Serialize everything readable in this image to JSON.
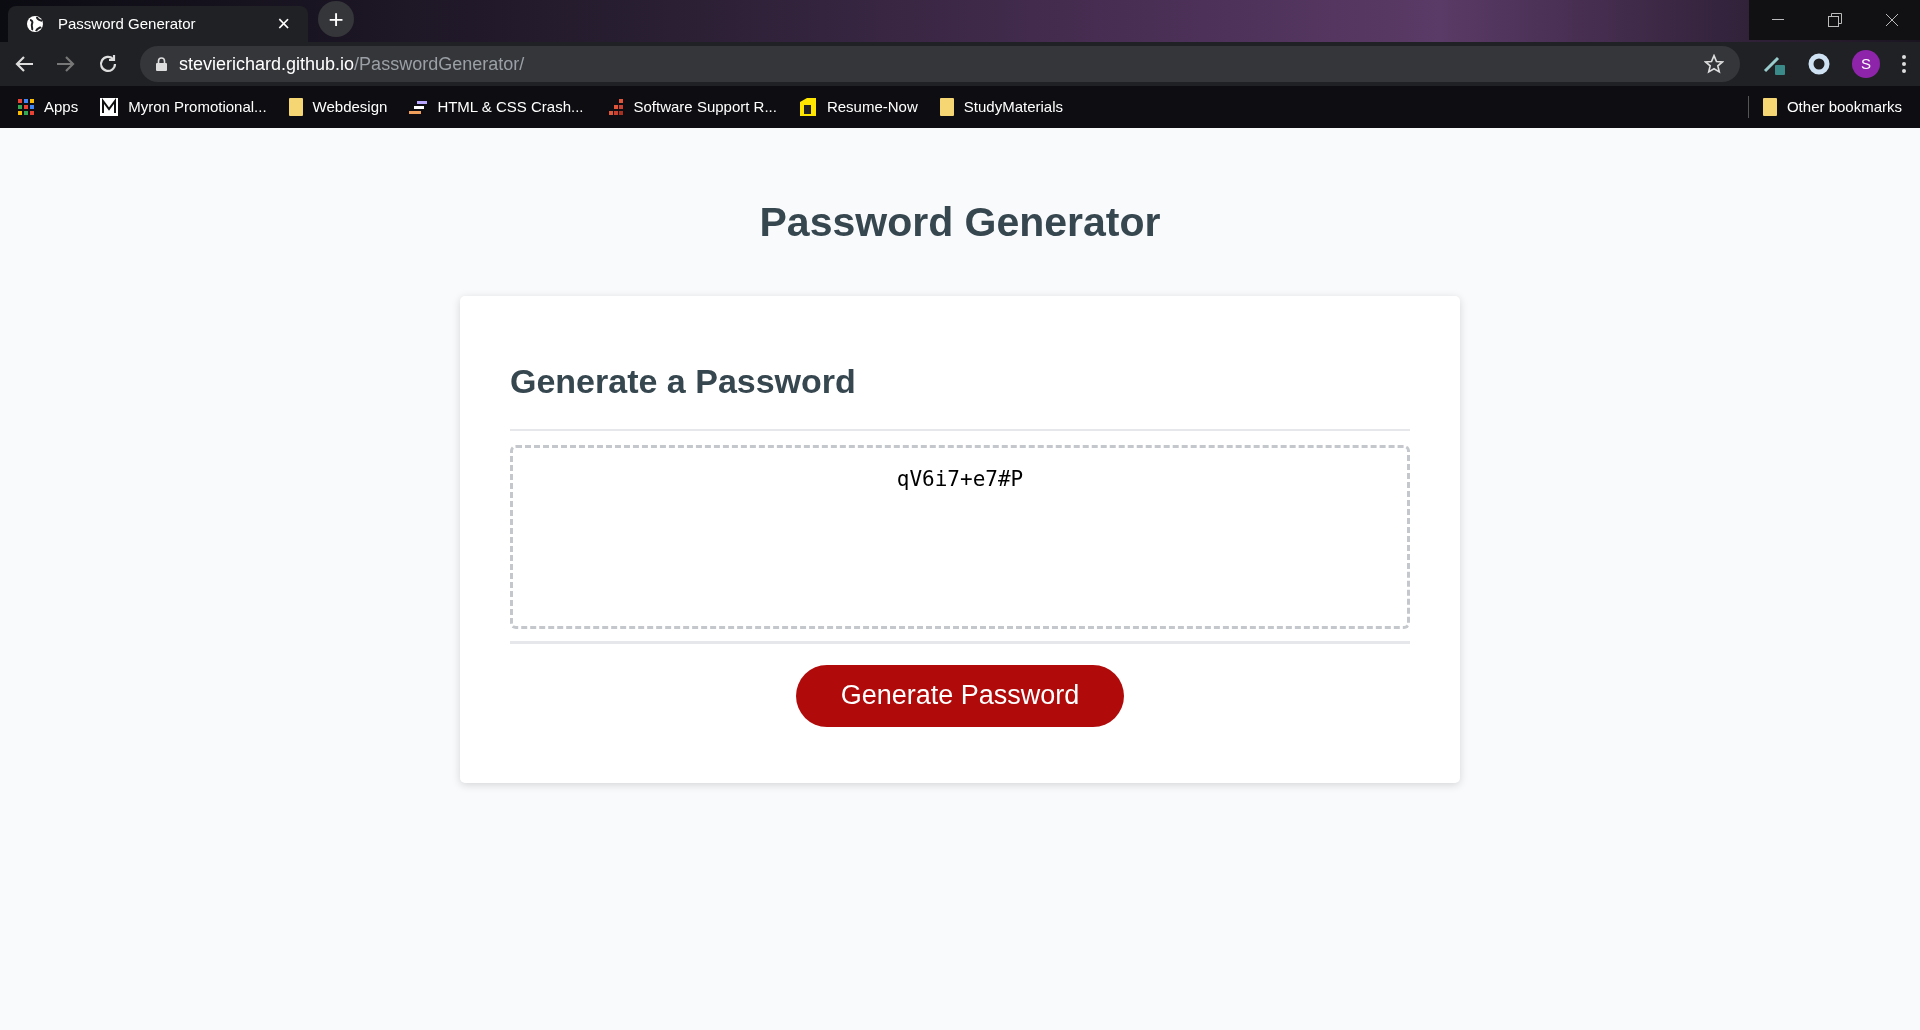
{
  "browser": {
    "tab": {
      "title": "Password Generator",
      "close": "×"
    },
    "new_tab": "+",
    "url_host": "stevierichard.github.io",
    "url_path": "/PasswordGenerator/",
    "avatar": "S",
    "bookmarks": [
      {
        "label": "Apps",
        "kind": "apps"
      },
      {
        "label": "Myron Promotional...",
        "kind": "m"
      },
      {
        "label": "Webdesign",
        "kind": "folder"
      },
      {
        "label": "HTML & CSS Crash...",
        "kind": "bars"
      },
      {
        "label": "Software Support R...",
        "kind": "stairs"
      },
      {
        "label": "Resume-Now",
        "kind": "doc"
      },
      {
        "label": "StudyMaterials",
        "kind": "folder"
      }
    ],
    "other_bookmarks": "Other bookmarks"
  },
  "page": {
    "title": "Password Generator",
    "card_title": "Generate a Password",
    "password": "qV6i7+e7#P",
    "button": "Generate Password"
  }
}
